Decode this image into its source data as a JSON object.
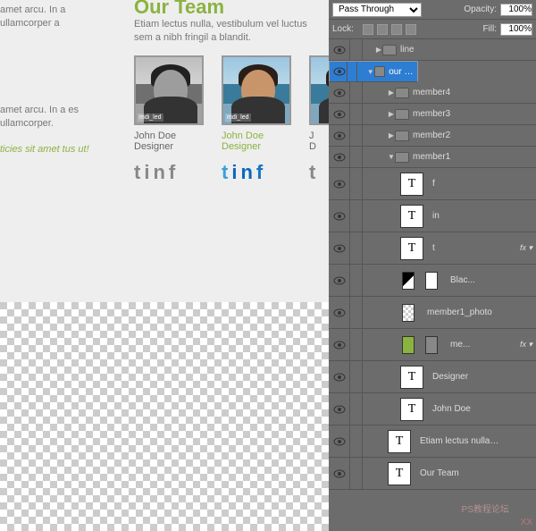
{
  "canvas": {
    "title": "Our Team",
    "subtitle": "Etiam lectus nulla, vestibulum vel luctus sem a nibh fringil a blandit.",
    "left_text_1": "amet arcu. In a ullamcorper a",
    "left_text_2": "amet arcu. In a es ullamcorper.",
    "left_text_3": "ticies sit amet tus ut!",
    "members": [
      {
        "name": "John Doe",
        "role": "Designer",
        "badge": "mdi_led"
      },
      {
        "name": "John Doe",
        "role": "Designer",
        "badge": "mdi_led"
      },
      {
        "name": "J",
        "role": "D",
        "badge": ""
      }
    ]
  },
  "toolbar": {
    "blend_mode": "Pass Through",
    "opacity_label": "Opacity:",
    "opacity_value": "100%",
    "lock_label": "Lock:",
    "fill_label": "Fill:",
    "fill_value": "100%"
  },
  "layers": [
    {
      "type": "group",
      "indent": 1,
      "name": "line",
      "expanded": false,
      "arrow": "▶",
      "selected": false
    },
    {
      "type": "group",
      "indent": 1,
      "name": "our team",
      "expanded": true,
      "arrow": "▼",
      "selected": true
    },
    {
      "type": "group",
      "indent": 2,
      "name": "member4",
      "expanded": false,
      "arrow": "▶"
    },
    {
      "type": "group",
      "indent": 2,
      "name": "member3",
      "expanded": false,
      "arrow": "▶"
    },
    {
      "type": "group",
      "indent": 2,
      "name": "member2",
      "expanded": false,
      "arrow": "▶"
    },
    {
      "type": "group",
      "indent": 2,
      "name": "member1",
      "expanded": true,
      "arrow": "▼"
    },
    {
      "type": "text",
      "indent": 3,
      "name": "f"
    },
    {
      "type": "text",
      "indent": 3,
      "name": "in"
    },
    {
      "type": "text",
      "indent": 3,
      "name": "t",
      "fx": true
    },
    {
      "type": "adj",
      "indent": 3,
      "name": "Blac...",
      "thumbs": [
        "grad",
        "white"
      ]
    },
    {
      "type": "smart",
      "indent": 3,
      "name": "member1_photo",
      "thumbs": [
        "check"
      ]
    },
    {
      "type": "shape",
      "indent": 3,
      "name": "me...",
      "thumbs": [
        "green",
        "gray"
      ],
      "fx": true
    },
    {
      "type": "text",
      "indent": 3,
      "name": "Designer"
    },
    {
      "type": "text",
      "indent": 3,
      "name": "John Doe"
    },
    {
      "type": "text",
      "indent": 2,
      "name": "Etiam lectus nulla, ..."
    },
    {
      "type": "text",
      "indent": 2,
      "name": "Our Team"
    }
  ],
  "watermark": "XX",
  "watermark2": "PS教程论坛"
}
